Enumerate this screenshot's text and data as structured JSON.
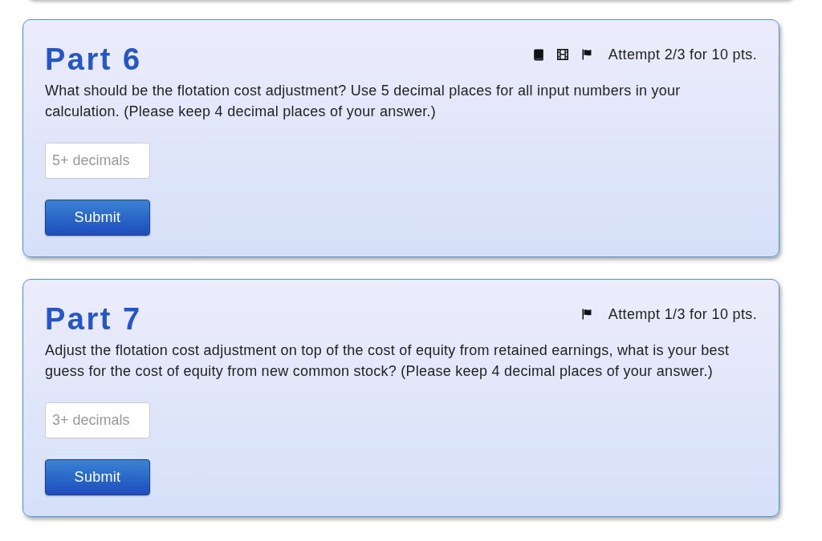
{
  "parts": [
    {
      "title": "Part 6",
      "tools": [
        {
          "kind": "book"
        },
        {
          "kind": "film"
        },
        {
          "kind": "flag"
        }
      ],
      "attempt": "Attempt 2/3 for 10 pts.",
      "question": "What should be the flotation cost adjustment? Use 5 decimal places for all input numbers in your calculation. (Please keep 4 decimal places of your answer.)",
      "answer": {
        "placeholder": "5+ decimals"
      },
      "submit": "Submit"
    },
    {
      "title": "Part 7",
      "tools": [
        {
          "kind": "flag"
        }
      ],
      "attempt": "Attempt 1/3 for 10 pts.",
      "question": "Adjust the flotation cost adjustment on top of the cost of equity from retained earnings, what is your best guess for the cost of equity from new common stock? (Please keep 4 decimal places of your answer.)",
      "answer": {
        "placeholder": "3+ decimals"
      },
      "submit": "Submit"
    }
  ]
}
